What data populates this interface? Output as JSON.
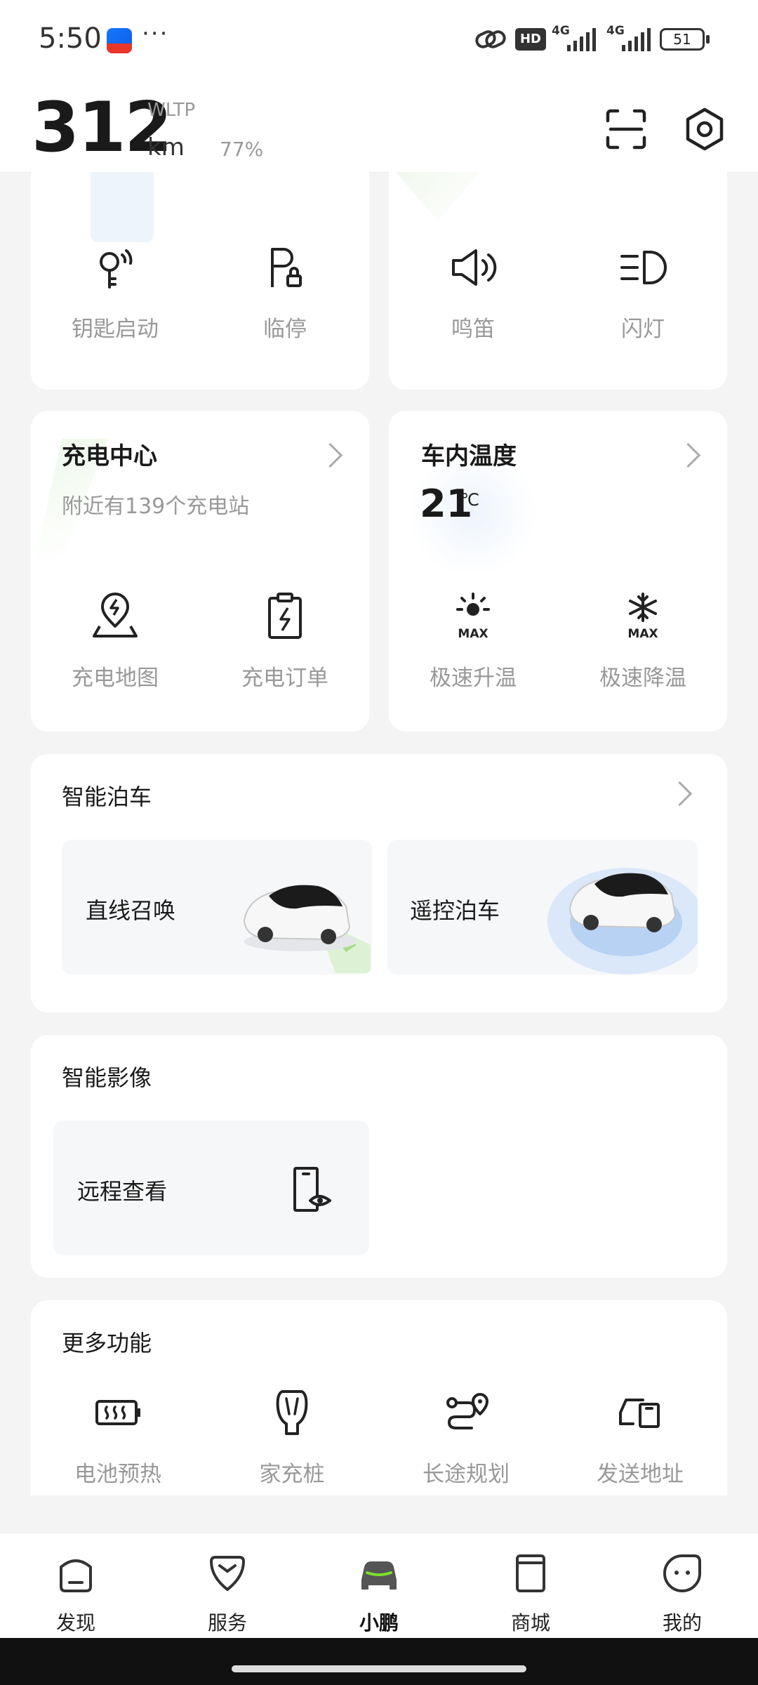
{
  "status_bar": {
    "time": "5:50",
    "more": "···",
    "network_1": "4G",
    "network_2": "4G",
    "battery": "51",
    "hd_label": "HD"
  },
  "header": {
    "range_value": "312",
    "range_standard": "WLTP",
    "range_unit": "km",
    "battery_percent": "77%"
  },
  "quick_actions_left": [
    {
      "label": "钥匙启动",
      "icon": "key-start-icon"
    },
    {
      "label": "临停",
      "icon": "temporary-parking-icon"
    }
  ],
  "quick_actions_right": [
    {
      "label": "鸣笛",
      "icon": "horn-icon"
    },
    {
      "label": "闪灯",
      "icon": "flash-lights-icon"
    }
  ],
  "charging": {
    "title": "充电中心",
    "subtitle": "附近有139个充电站",
    "actions": [
      {
        "label": "充电地图",
        "icon": "charging-map-icon"
      },
      {
        "label": "充电订单",
        "icon": "charging-order-icon"
      }
    ]
  },
  "climate": {
    "title": "车内温度",
    "temperature": "21",
    "unit": "℃",
    "actions": [
      {
        "label": "极速升温",
        "icon": "max-heat-icon",
        "badge": "MAX"
      },
      {
        "label": "极速降温",
        "icon": "max-cool-icon",
        "badge": "MAX"
      }
    ]
  },
  "smart_parking": {
    "title": "智能泊车",
    "tiles": [
      {
        "label": "直线召唤"
      },
      {
        "label": "遥控泊车"
      }
    ]
  },
  "smart_video": {
    "title": "智能影像",
    "tiles": [
      {
        "label": "远程查看"
      }
    ]
  },
  "more_functions": {
    "title": "更多功能",
    "items": [
      {
        "label": "电池预热",
        "icon": "battery-preheat-icon"
      },
      {
        "label": "家充桩",
        "icon": "home-charger-icon"
      },
      {
        "label": "长途规划",
        "icon": "route-plan-icon"
      },
      {
        "label": "发送地址",
        "icon": "send-address-icon"
      }
    ]
  },
  "bottom_nav": [
    {
      "label": "发现",
      "icon": "discover-icon",
      "active": false
    },
    {
      "label": "服务",
      "icon": "service-icon",
      "active": false
    },
    {
      "label": "小鹏",
      "icon": "car-icon",
      "active": true
    },
    {
      "label": "商城",
      "icon": "shop-icon",
      "active": false
    },
    {
      "label": "我的",
      "icon": "profile-icon",
      "active": false
    }
  ],
  "colors": {
    "accent_green": "#7ee02a",
    "text_primary": "#1a1a1a",
    "text_secondary": "#999999",
    "page_background": "#f4f4f4"
  }
}
